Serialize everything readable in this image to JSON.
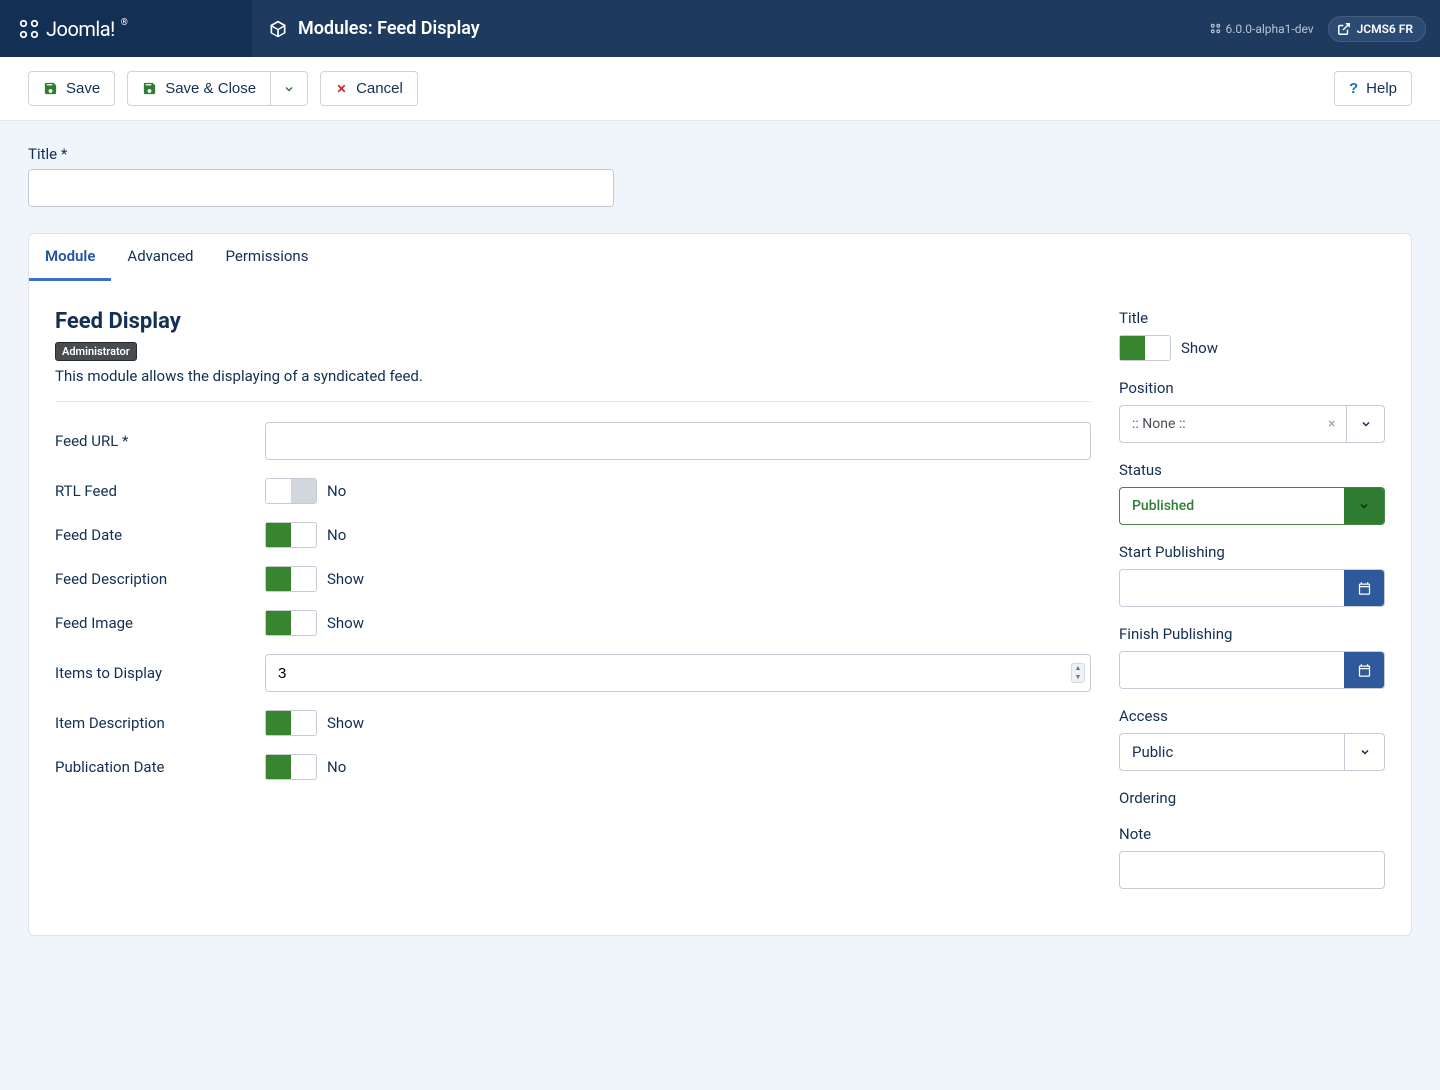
{
  "brand": "Joomla!",
  "page_title": "Modules: Feed Display",
  "version": "6.0.0-alpha1-dev",
  "user": "JCMS6 FR",
  "toolbar": {
    "save": "Save",
    "save_close": "Save & Close",
    "cancel": "Cancel",
    "help": "Help"
  },
  "title_label": "Title *",
  "title_value": "",
  "tabs": {
    "module": "Module",
    "advanced": "Advanced",
    "permissions": "Permissions"
  },
  "module": {
    "heading": "Feed Display",
    "chip": "Administrator",
    "desc": "This module allows the displaying of a syndicated feed.",
    "fields": {
      "feed_url": {
        "label": "Feed URL *",
        "value": ""
      },
      "rtl_feed": {
        "label": "RTL Feed",
        "state": "off",
        "text": "No"
      },
      "feed_date": {
        "label": "Feed Date",
        "state": "on",
        "text": "No"
      },
      "feed_desc": {
        "label": "Feed Description",
        "state": "on",
        "text": "Show"
      },
      "feed_image": {
        "label": "Feed Image",
        "state": "on",
        "text": "Show"
      },
      "items": {
        "label": "Items to Display",
        "value": "3"
      },
      "item_desc": {
        "label": "Item Description",
        "state": "on",
        "text": "Show"
      },
      "pub_date": {
        "label": "Publication Date",
        "state": "on",
        "text": "No"
      }
    }
  },
  "side": {
    "title": {
      "label": "Title",
      "state": "on",
      "text": "Show"
    },
    "position": {
      "label": "Position",
      "value": ":: None ::"
    },
    "status": {
      "label": "Status",
      "value": "Published"
    },
    "start_pub": {
      "label": "Start Publishing",
      "value": ""
    },
    "finish_pub": {
      "label": "Finish Publishing",
      "value": ""
    },
    "access": {
      "label": "Access",
      "value": "Public"
    },
    "ordering": {
      "label": "Ordering"
    },
    "note": {
      "label": "Note",
      "value": ""
    }
  }
}
